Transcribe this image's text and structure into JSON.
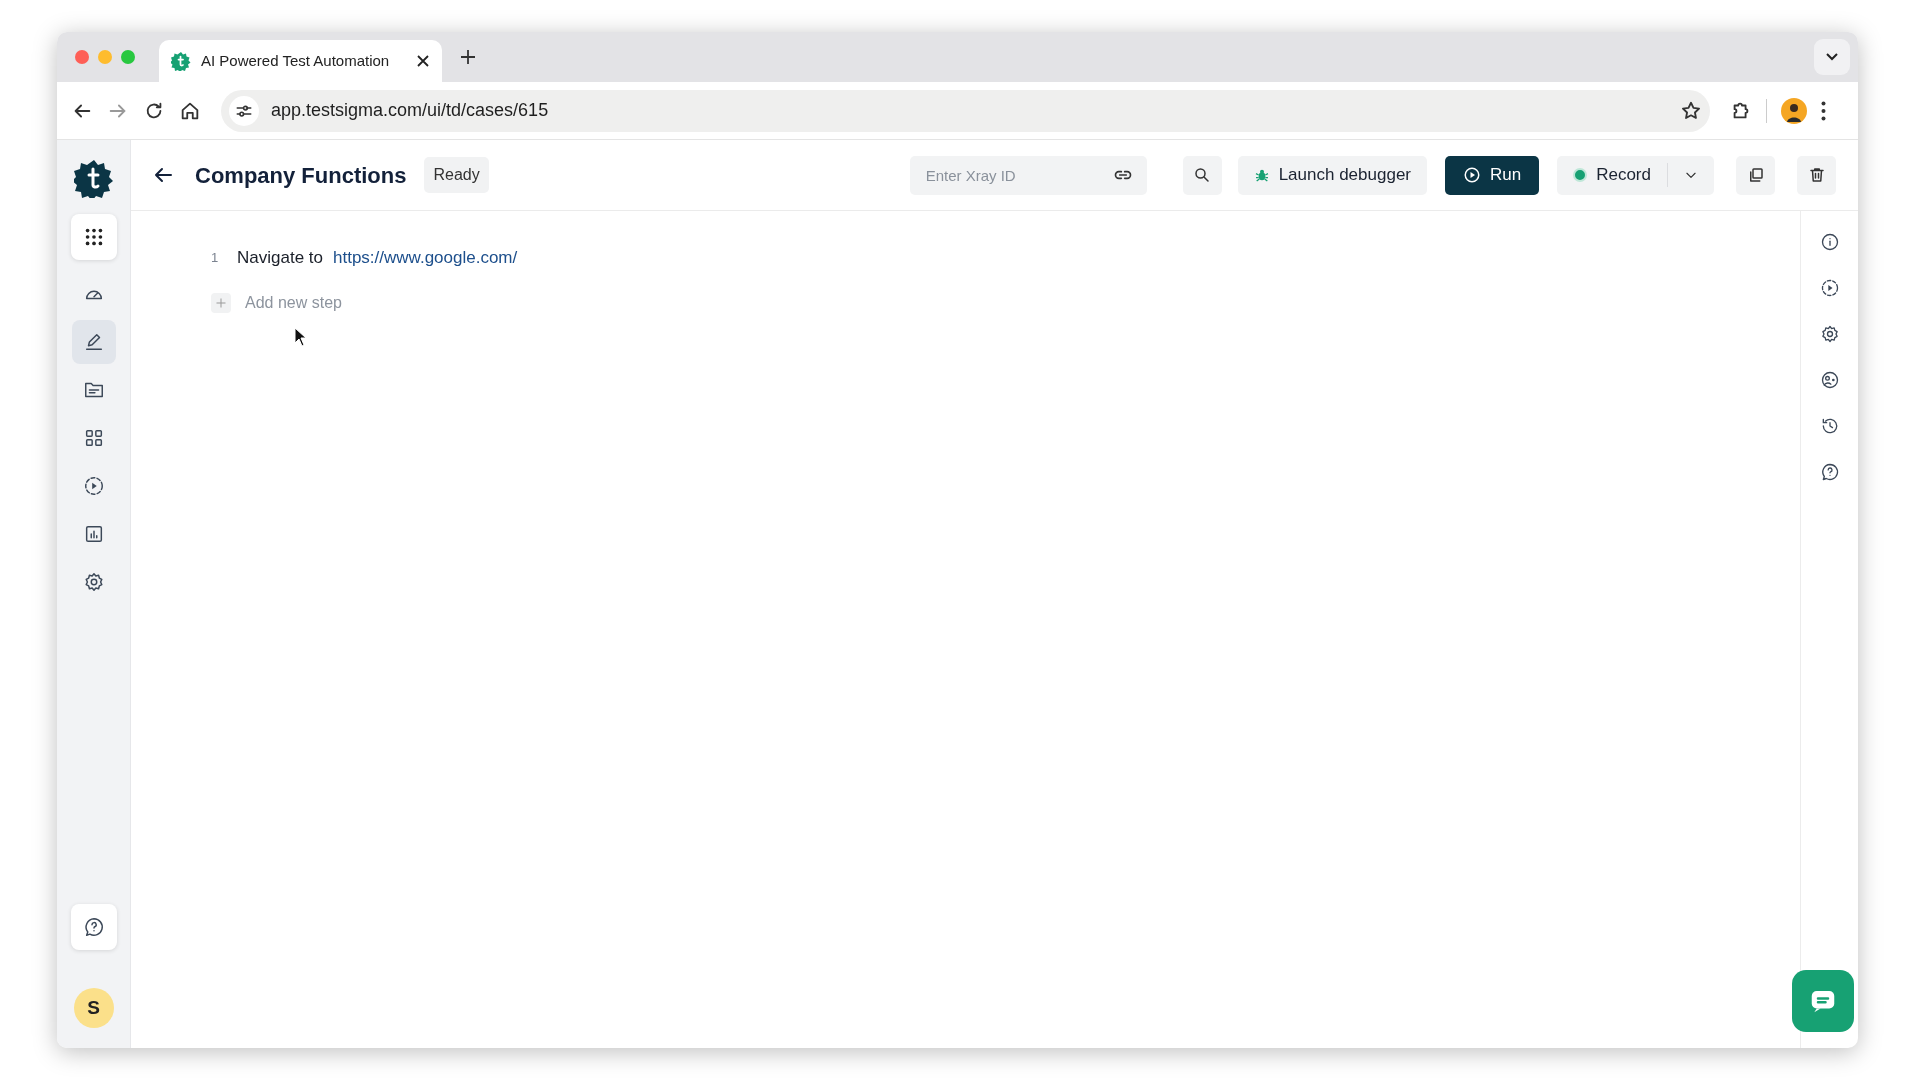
{
  "browser": {
    "tab": {
      "title": "AI Powered Test Automation"
    },
    "address": "app.testsigma.com/ui/td/cases/615"
  },
  "sidebar": {
    "items": [
      {
        "kind": "dashboard",
        "selected": false
      },
      {
        "kind": "editor",
        "selected": true
      },
      {
        "kind": "files",
        "selected": false
      },
      {
        "kind": "modules",
        "selected": false
      },
      {
        "kind": "runs",
        "selected": false
      },
      {
        "kind": "reports",
        "selected": false
      },
      {
        "kind": "settings",
        "selected": false
      }
    ],
    "avatar": "S"
  },
  "header": {
    "title": "Company Functions",
    "status": "Ready",
    "xray": {
      "placeholder": "Enter Xray ID"
    },
    "debugger_button": "Launch debugger",
    "run_button": "Run",
    "record_button": "Record"
  },
  "steps": [
    {
      "number": "1",
      "action": "Navigate to",
      "url": "https://www.google.com/"
    }
  ],
  "add_step": "Add new step",
  "right_rail": [
    {
      "kind": "info"
    },
    {
      "kind": "runs"
    },
    {
      "kind": "settings"
    },
    {
      "kind": "face"
    },
    {
      "kind": "history"
    },
    {
      "kind": "help"
    }
  ]
}
